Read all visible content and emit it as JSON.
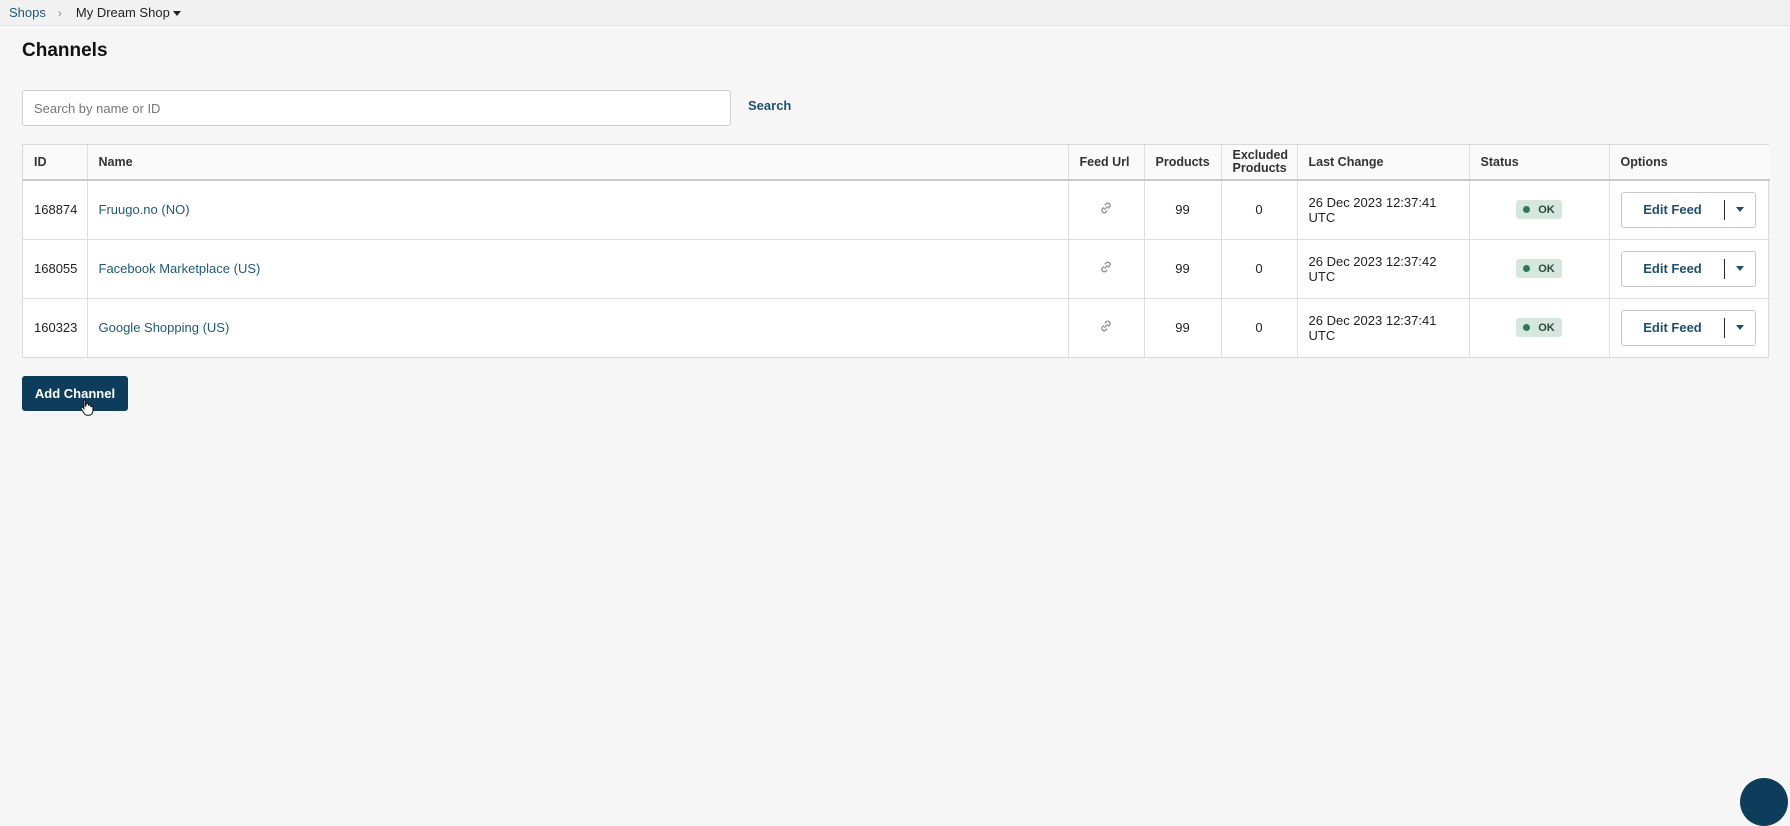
{
  "breadcrumb": {
    "root": "Shops",
    "separator": "›",
    "current": "My Dream Shop"
  },
  "page": {
    "title": "Channels"
  },
  "search": {
    "placeholder": "Search by name or ID",
    "button_label": "Search"
  },
  "table": {
    "columns": {
      "id": "ID",
      "name": "Name",
      "feed_url": "Feed Url",
      "products": "Products",
      "excluded_line1": "Excluded",
      "excluded_line2": "Products",
      "last_change": "Last Change",
      "status": "Status",
      "options": "Options"
    },
    "rows": [
      {
        "id": "168874",
        "name": "Fruugo.no (NO)",
        "products": "99",
        "excluded": "0",
        "last_change": "26 Dec 2023 12:37:41 UTC",
        "status": "OK",
        "action": "Edit Feed"
      },
      {
        "id": "168055",
        "name": "Facebook Marketplace (US)",
        "products": "99",
        "excluded": "0",
        "last_change": "26 Dec 2023 12:37:42 UTC",
        "status": "OK",
        "action": "Edit Feed"
      },
      {
        "id": "160323",
        "name": "Google Shopping (US)",
        "products": "99",
        "excluded": "0",
        "last_change": "26 Dec 2023 12:37:41 UTC",
        "status": "OK",
        "action": "Edit Feed"
      }
    ]
  },
  "add_button_label": "Add Channel",
  "colors": {
    "link": "#1f5a7a",
    "primary": "#0d3d5a",
    "status_ok_bg": "#d6e7de",
    "status_ok_dot": "#2f7a55"
  },
  "icons": {
    "feed_url": "link-icon",
    "breadcrumb_dropdown": "caret-down-icon",
    "options_dropdown": "chevron-down-icon"
  }
}
